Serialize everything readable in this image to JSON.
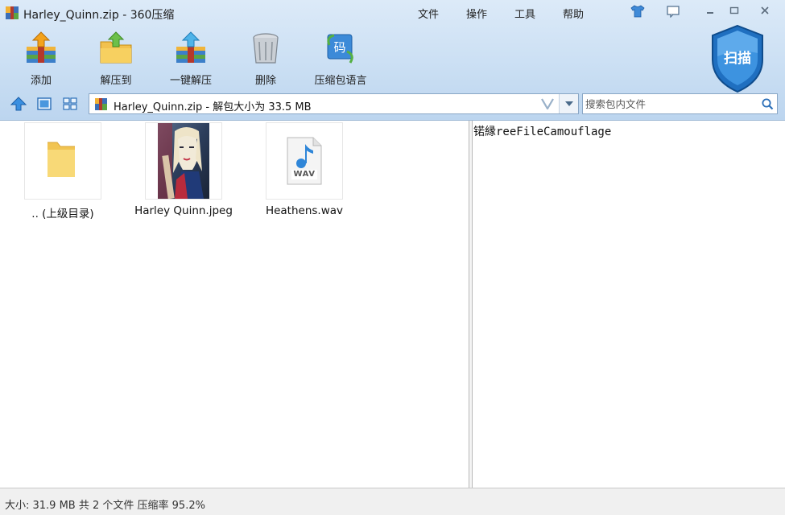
{
  "window": {
    "title": "Harley_Quinn.zip - 360压缩"
  },
  "menu": [
    "文件",
    "操作",
    "工具",
    "帮助"
  ],
  "toolbar": {
    "add": "添加",
    "extract_to": "解压到",
    "one_click_extract": "一键解压",
    "delete": "删除",
    "archive_language": "压缩包语言"
  },
  "scan": {
    "label": "扫描"
  },
  "address": {
    "path": "Harley_Quinn.zip - 解包大小为 33.5 MB"
  },
  "search": {
    "placeholder": "搜索包内文件"
  },
  "files": [
    {
      "name": ".. (上级目录)",
      "icon": "folder-icon"
    },
    {
      "name": "Harley Quinn.jpeg",
      "icon": "image-thumbnail"
    },
    {
      "name": "Heathens.wav",
      "icon": "wav-file-icon",
      "badge": "WAV"
    }
  ],
  "comment": "锘縁reeFileCamouflage",
  "status": "大小: 31.9 MB 共 2 个文件 压缩率 95.2%",
  "colors": {
    "toolbar_bg": "#c9def3",
    "accent": "#2b7fd4",
    "shield": "#1f6fc0"
  }
}
